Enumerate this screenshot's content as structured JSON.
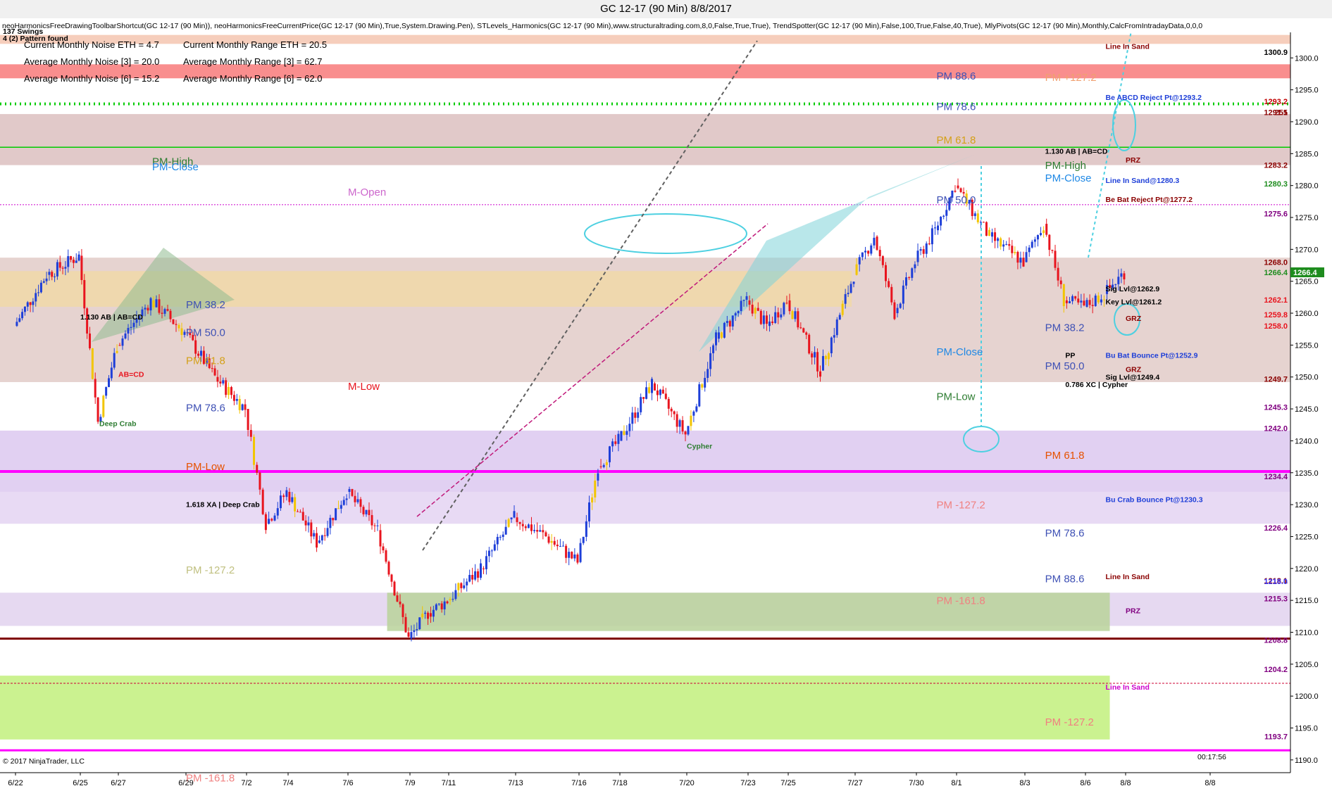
{
  "window": {
    "title": "GC 12-17 (90 Min)  8/8/2017",
    "indicators": "neoHarmonicsFreeDrawingToolbarShortcut(GC 12-17 (90 Min)), neoHarmonicsFreeCurrentPrice(GC 12-17 (90 Min),True,System.Drawing.Pen), STLevels_Harmonics(GC 12-17 (90 Min),www.structuraltrading.com,8,0,False,True,True), TrendSpotter(GC 12-17 (90 Min),False,100,True,False,40,True), MlyPivots(GC 12-17 (90 Min),Monthly,CalcFromIntradayData,0,0,0",
    "copyright": "© 2017 NinjaTrader, LLC",
    "timer": "00:17:56"
  },
  "info_box": [
    "137 Swings",
    "4 (2) Pattern found",
    "Current Monthly Noise ETH = 4.7",
    "Current Monthly Range ETH = 20.5",
    "Average Monthly Noise [3] = 20.0",
    "Average Monthly Range [3] = 62.7",
    "Average Monthly Noise [6] = 15.2",
    "Average Monthly Range [6] = 62.0"
  ],
  "chart_data": {
    "type": "candlestick",
    "symbol": "GC 12-17",
    "interval": "90 Min",
    "ylim": [
      1188,
      1304
    ],
    "y_ticks": [
      1190.0,
      1195.0,
      1200.0,
      1205.0,
      1210.0,
      1215.0,
      1220.0,
      1225.0,
      1230.0,
      1235.0,
      1240.0,
      1245.0,
      1250.0,
      1255.0,
      1260.0,
      1265.0,
      1270.0,
      1275.0,
      1280.0,
      1285.0,
      1290.0,
      1295.0,
      1300.0
    ],
    "x_ticks": [
      "6/22",
      "6/25",
      "6/27",
      "6/29",
      "7/2",
      "7/4",
      "7/6",
      "7/9",
      "7/11",
      "7/13",
      "7/16",
      "7/18",
      "7/20",
      "7/23",
      "7/25",
      "7/27",
      "7/30",
      "8/1",
      "8/3",
      "8/6",
      "8/8",
      "8/8"
    ],
    "colors": {
      "up": "#1e3fd8",
      "down": "#e8141e",
      "neutral": "#f2c500",
      "last": "#1e8c1e"
    },
    "price_path": [
      {
        "x": "6/22",
        "y": 1258
      },
      {
        "x": "6/23",
        "y": 1266
      },
      {
        "x": "6/25",
        "y": 1269
      },
      {
        "x": "6/26",
        "y": 1243
      },
      {
        "x": "6/27",
        "y": 1255
      },
      {
        "x": "6/28",
        "y": 1262
      },
      {
        "x": "6/29",
        "y": 1257
      },
      {
        "x": "6/30",
        "y": 1250
      },
      {
        "x": "7/2",
        "y": 1245
      },
      {
        "x": "7/3",
        "y": 1227
      },
      {
        "x": "7/4",
        "y": 1232
      },
      {
        "x": "7/5",
        "y": 1224
      },
      {
        "x": "7/6",
        "y": 1232
      },
      {
        "x": "7/7",
        "y": 1226
      },
      {
        "x": "7/9",
        "y": 1209
      },
      {
        "x": "7/10",
        "y": 1213
      },
      {
        "x": "7/11",
        "y": 1215
      },
      {
        "x": "7/12",
        "y": 1220
      },
      {
        "x": "7/13",
        "y": 1228
      },
      {
        "x": "7/14",
        "y": 1225
      },
      {
        "x": "7/16",
        "y": 1221
      },
      {
        "x": "7/17",
        "y": 1236
      },
      {
        "x": "7/18",
        "y": 1240
      },
      {
        "x": "7/19",
        "y": 1249
      },
      {
        "x": "7/20",
        "y": 1241
      },
      {
        "x": "7/21",
        "y": 1256
      },
      {
        "x": "7/23",
        "y": 1262
      },
      {
        "x": "7/24",
        "y": 1258
      },
      {
        "x": "7/25",
        "y": 1262
      },
      {
        "x": "7/26",
        "y": 1251
      },
      {
        "x": "7/27",
        "y": 1266
      },
      {
        "x": "7/28",
        "y": 1272
      },
      {
        "x": "7/29",
        "y": 1260
      },
      {
        "x": "7/30",
        "y": 1268
      },
      {
        "x": "7/31",
        "y": 1273
      },
      {
        "x": "8/1",
        "y": 1280
      },
      {
        "x": "8/2",
        "y": 1272
      },
      {
        "x": "8/3",
        "y": 1268
      },
      {
        "x": "8/4",
        "y": 1274
      },
      {
        "x": "8/5",
        "y": 1262
      },
      {
        "x": "8/6",
        "y": 1261
      },
      {
        "x": "8/7",
        "y": 1263
      },
      {
        "x": "8/8",
        "y": 1266.4
      }
    ],
    "current_price": 1266.4,
    "price_labels": [
      {
        "text": "1300.9",
        "y": 1300.9,
        "color": "#000000"
      },
      {
        "text": "1293.2",
        "y": 1293.2,
        "color": "#c00000"
      },
      {
        "text": "251",
        "y": 1291.5,
        "color": "#8b0000"
      },
      {
        "text": "1291.5",
        "y": 1291.5,
        "color": "#8b0000"
      },
      {
        "text": "1283.2",
        "y": 1283.2,
        "color": "#8b0000"
      },
      {
        "text": "1280.3",
        "y": 1280.3,
        "color": "#1e8c1e"
      },
      {
        "text": "1275.6",
        "y": 1275.6,
        "color": "#800080"
      },
      {
        "text": "1268.0",
        "y": 1268.0,
        "color": "#8b0000"
      },
      {
        "text": "1266.4",
        "y": 1266.4,
        "color": "#1e8c1e"
      },
      {
        "text": "1262.1",
        "y": 1262.1,
        "color": "#e8141e"
      },
      {
        "text": "1259.8",
        "y": 1259.8,
        "color": "#e8141e"
      },
      {
        "text": "1258.0",
        "y": 1258.0,
        "color": "#e8141e"
      },
      {
        "text": "1249.7",
        "y": 1249.7,
        "color": "#8b0000"
      },
      {
        "text": "1245.3",
        "y": 1245.3,
        "color": "#800080"
      },
      {
        "text": "1242.0",
        "y": 1242.0,
        "color": "#800080"
      },
      {
        "text": "1234.4",
        "y": 1234.4,
        "color": "#800080"
      },
      {
        "text": "1226.4",
        "y": 1226.4,
        "color": "#800080"
      },
      {
        "text": "1218.1",
        "y": 1218.1,
        "color": "#8b0000"
      },
      {
        "text": "1218.0",
        "y": 1218.0,
        "color": "#4040ff"
      },
      {
        "text": "1215.3",
        "y": 1215.3,
        "color": "#800080"
      },
      {
        "text": "1208.8",
        "y": 1208.8,
        "color": "#800080"
      },
      {
        "text": "1204.2",
        "y": 1204.2,
        "color": "#800080"
      },
      {
        "text": "1193.7",
        "y": 1193.7,
        "color": "#800080"
      }
    ],
    "zones": [
      {
        "y1": 1303.6,
        "y2": 1302.2,
        "color": "#f4c6b0"
      },
      {
        "y1": 1299.0,
        "y2": 1296.8,
        "color": "#f87a7a"
      },
      {
        "y1": 1291.2,
        "y2": 1283.2,
        "color": "#dcc0c0"
      },
      {
        "y1": 1268.7,
        "y2": 1249.2,
        "color": "#e2cbc8"
      },
      {
        "y1": 1266.6,
        "y2": 1261.0,
        "color": "#f0d8a8",
        "x1f": 0.0,
        "x2f": 0.66
      },
      {
        "y1": 1241.6,
        "y2": 1232.0,
        "color": "#dcc8f0"
      },
      {
        "y1": 1232.0,
        "y2": 1227.0,
        "color": "#e4d4f2"
      },
      {
        "y1": 1216.2,
        "y2": 1211.0,
        "color": "#e2d2ee"
      },
      {
        "y1": 1216.2,
        "y2": 1210.2,
        "color": "#b8d29a",
        "x1f": 0.3,
        "x2f": 0.86
      },
      {
        "y1": 1203.2,
        "y2": 1193.2,
        "color": "#c2f07c",
        "x2f": 0.86
      }
    ],
    "levels": [
      {
        "y": 1235.2,
        "color": "#ff00ff",
        "width": 4,
        "dash": "",
        "label": ""
      },
      {
        "y": 1209.0,
        "color": "#800000",
        "width": 3,
        "dash": "",
        "label": ""
      },
      {
        "y": 1292.8,
        "color": "#00cc00",
        "width": 4,
        "dash": "2,5",
        "label": ""
      },
      {
        "y": 1286.0,
        "color": "#00cc00",
        "width": 1.5,
        "dash": "",
        "label": ""
      },
      {
        "y": 1277.0,
        "color": "#cc00cc",
        "width": 1,
        "dash": "2,2",
        "label": ""
      },
      {
        "y": 1191.5,
        "color": "#ff00ff",
        "width": 3,
        "dash": "",
        "label": ""
      },
      {
        "y": 1202.0,
        "color": "#cc0033",
        "width": 1,
        "dash": "3,2",
        "label": ""
      }
    ],
    "pivot_labels": [
      {
        "text": "PM-High",
        "x": "6/28",
        "y": 1283.2,
        "color": "#2e7d32"
      },
      {
        "text": "PM-Close",
        "x": "6/28",
        "y": 1282.4,
        "color": "#1e88e5"
      },
      {
        "text": "M-Open",
        "x": "7/6",
        "y": 1278.4,
        "color": "#cc66cc"
      },
      {
        "text": "PM 38.2",
        "x": "6/29",
        "y": 1260.8,
        "color": "#3f51b5"
      },
      {
        "text": "PM 50.0",
        "x": "6/29",
        "y": 1256.4,
        "color": "#3f51b5"
      },
      {
        "text": "PM 61.8",
        "x": "6/29",
        "y": 1252.0,
        "color": "#d4a017"
      },
      {
        "text": "M-Low",
        "x": "7/6",
        "y": 1248.0,
        "color": "#e8141e"
      },
      {
        "text": "PM 78.6",
        "x": "6/29",
        "y": 1244.6,
        "color": "#3f51b5"
      },
      {
        "text": "PM-Low",
        "x": "6/29",
        "y": 1235.4,
        "color": "#e65100"
      },
      {
        "text": "PM 88.6",
        "x": "7/31",
        "y": 1296.6,
        "color": "#3f51b5"
      },
      {
        "text": "PM 78.6",
        "x": "7/31",
        "y": 1291.8,
        "color": "#3f51b5"
      },
      {
        "text": "PM 61.8",
        "x": "7/31",
        "y": 1286.6,
        "color": "#d4a017"
      },
      {
        "text": "PM 50.0",
        "x": "7/31",
        "y": 1277.2,
        "color": "#3f51b5"
      },
      {
        "text": "PM-Close",
        "x": "7/31",
        "y": 1253.4,
        "color": "#1e88e5"
      },
      {
        "text": "PM-Low",
        "x": "7/31",
        "y": 1246.4,
        "color": "#2e7d32"
      },
      {
        "text": "PM -127.2",
        "x": "7/31",
        "y": 1229.4,
        "color": "#f08080"
      },
      {
        "text": "PM -161.8",
        "x": "7/31",
        "y": 1214.4,
        "color": "#f08080"
      },
      {
        "text": "PM +127.2",
        "x": "8/4",
        "y": 1296.4,
        "color": "#f0a070"
      },
      {
        "text": "PM-High",
        "x": "8/4",
        "y": 1282.6,
        "color": "#2e7d32"
      },
      {
        "text": "PM-Close",
        "x": "8/4",
        "y": 1280.6,
        "color": "#1e88e5"
      },
      {
        "text": "PM 38.2",
        "x": "8/4",
        "y": 1257.2,
        "color": "#3f51b5"
      },
      {
        "text": "PM 50.0",
        "x": "8/4",
        "y": 1251.2,
        "color": "#3f51b5"
      },
      {
        "text": "PM 61.8",
        "x": "8/4",
        "y": 1237.2,
        "color": "#e65100"
      },
      {
        "text": "PM 78.6",
        "x": "8/4",
        "y": 1225.0,
        "color": "#3f51b5"
      },
      {
        "text": "PM 88.6",
        "x": "8/4",
        "y": 1217.8,
        "color": "#3f51b5"
      },
      {
        "text": "PM -127.2",
        "x": "8/4",
        "y": 1195.4,
        "color": "#f08080"
      },
      {
        "text": "PM -127.2",
        "x": "6/29",
        "y": 1219.2,
        "color": "#c0c080"
      },
      {
        "text": "PM -161.8",
        "x": "6/29",
        "y": 1186.6,
        "color": "#f08080"
      }
    ],
    "annotations": [
      {
        "text": "1.130 AB | AB=CD",
        "x": "6/25",
        "y": 1259.0,
        "color": "#000000"
      },
      {
        "text": "AB=CD",
        "x": "6/27",
        "y": 1250.0,
        "color": "#e8141e"
      },
      {
        "text": "Deep Crab",
        "x": "6/26",
        "y": 1242.3,
        "color": "#2e7d32"
      },
      {
        "text": "1.618 XA | Deep Crab",
        "x": "6/29",
        "y": 1229.6,
        "color": "#000000"
      },
      {
        "text": "Cypher",
        "x": "7/20",
        "y": 1238.8,
        "color": "#2e7d32"
      },
      {
        "text": "1.130 AB | AB=CD",
        "x": "8/4",
        "y": 1285.0,
        "color": "#000000"
      },
      {
        "text": "0.786 XC | Cypher",
        "x": "8/5",
        "y": 1248.4,
        "color": "#000000"
      },
      {
        "text": "Sig Lvl@1262.9",
        "x": "8/7",
        "y": 1263.4,
        "color": "#000000"
      },
      {
        "text": "Key Lvl@1261.2",
        "x": "8/7",
        "y": 1261.4,
        "color": "#000000"
      },
      {
        "text": "Sig Lvl@1249.4",
        "x": "8/7",
        "y": 1249.6,
        "color": "#000000"
      },
      {
        "text": "Be Bat Reject Pt@1277.2",
        "x": "8/7",
        "y": 1277.4,
        "color": "#8b0000"
      },
      {
        "text": "Bu Bat Bounce Pt@1252.9",
        "x": "8/7",
        "y": 1253.0,
        "color": "#1e3fd8"
      },
      {
        "text": "Bu Crab Bounce Pt@1230.3",
        "x": "8/7",
        "y": 1230.4,
        "color": "#1e3fd8"
      },
      {
        "text": "Line In Sand",
        "x": "8/7",
        "y": 1218.3,
        "color": "#8b0000"
      },
      {
        "text": "Line In Sand",
        "x": "8/7",
        "y": 1301.4,
        "color": "#8b0000"
      },
      {
        "text": "Line In Sand",
        "x": "8/7",
        "y": 1201.0,
        "color": "#cc00cc"
      },
      {
        "text": "Line In Sand@1280.3",
        "x": "8/7",
        "y": 1280.4,
        "color": "#1e3fd8"
      },
      {
        "text": "Be ABCD Reject Pt@1293.2",
        "x": "8/7",
        "y": 1293.4,
        "color": "#1e3fd8"
      },
      {
        "text": "PP",
        "x": "8/5",
        "y": 1253.0,
        "color": "#000000"
      },
      {
        "text": "PRZ",
        "x": "8/8",
        "y": 1283.6,
        "color": "#8b0000"
      },
      {
        "text": "GRZ",
        "x": "8/8",
        "y": 1258.8,
        "color": "#8b0000"
      },
      {
        "text": "GRZ",
        "x": "8/8",
        "y": 1250.8,
        "color": "#8b0000"
      },
      {
        "text": "PRZ",
        "x": "8/8",
        "y": 1213.0,
        "color": "#800080"
      }
    ]
  }
}
